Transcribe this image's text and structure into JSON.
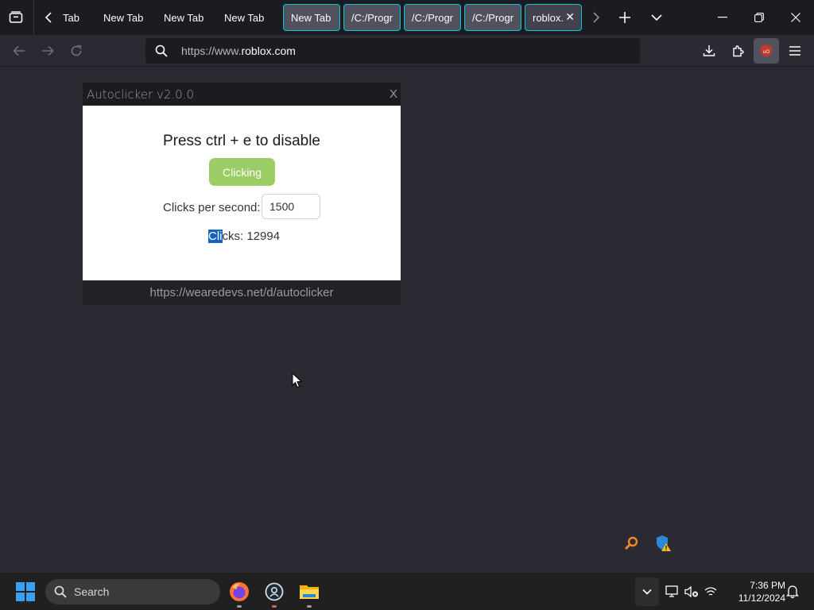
{
  "browser": {
    "tabs": [
      {
        "label": "Tab",
        "style": "plain"
      },
      {
        "label": "New Tab",
        "style": "plain"
      },
      {
        "label": "New Tab",
        "style": "plain"
      },
      {
        "label": "New Tab",
        "style": "plain"
      },
      {
        "label": "New Tab",
        "style": "boxed"
      },
      {
        "label": "/C:/Progr",
        "style": "boxed"
      },
      {
        "label": "/C:/Progr",
        "style": "boxed"
      },
      {
        "label": "/C:/Progr",
        "style": "boxed"
      },
      {
        "label": "roblox.",
        "style": "active"
      }
    ],
    "url_prefix": "https://www.",
    "url_domain": "roblox.com"
  },
  "autoclicker": {
    "title": "Autoclicker v2.0.0",
    "close_label": "X",
    "instruction": "Press ctrl + e to disable",
    "toggle_label": "Clicking",
    "cps_label": "Clicks per second:",
    "cps_value": "1500",
    "clicks_label_selected": "Cli",
    "clicks_label_rest": "cks: 12994",
    "footer_link": "https://wearedevs.net/d/autoclicker"
  },
  "taskbar": {
    "search_label": "Search",
    "time": "7:36 PM",
    "date": "11/12/2024"
  },
  "colors": {
    "accent_tab_border": "#00c8d7",
    "clicking_button": "#9ccc65",
    "selection": "#1565c0",
    "ublock_red": "#c0392b"
  },
  "icons": [
    "tab-list-icon",
    "chevron-left-icon",
    "chevron-right-icon",
    "plus-icon",
    "chevron-down-icon",
    "minimize-icon",
    "restore-icon",
    "close-icon",
    "back-arrow-icon",
    "forward-arrow-icon",
    "reload-icon",
    "search-icon",
    "download-icon",
    "extensions-icon",
    "ublock-icon",
    "hamburger-menu-icon",
    "windows-start-icon",
    "firefox-icon",
    "app-icon",
    "file-explorer-icon"
  ]
}
